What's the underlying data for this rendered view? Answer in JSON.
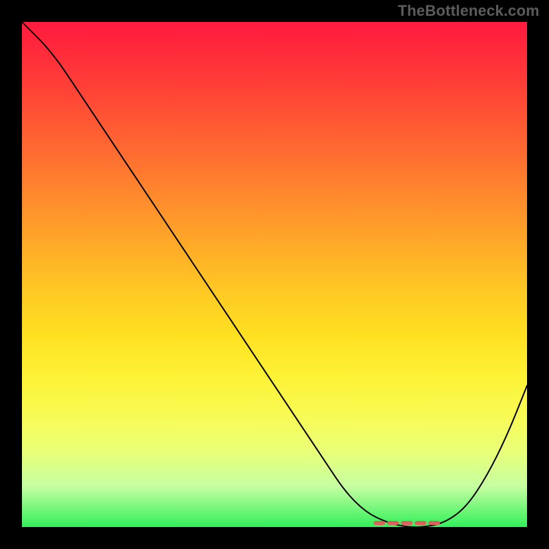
{
  "watermark": "TheBottleneck.com",
  "chart_data": {
    "type": "line",
    "title": "",
    "xlabel": "",
    "ylabel": "",
    "xlim": [
      0,
      100
    ],
    "ylim": [
      0,
      100
    ],
    "series": [
      {
        "name": "bottleneck-curve",
        "x": [
          0,
          6,
          12,
          18,
          24,
          30,
          36,
          42,
          48,
          54,
          60,
          64,
          68,
          72,
          76,
          80,
          84,
          88,
          92,
          96,
          100
        ],
        "y": [
          100,
          94,
          85,
          76,
          67,
          58,
          49,
          40,
          31,
          22,
          13,
          7,
          3,
          1,
          0,
          0,
          1,
          4,
          10,
          18,
          28
        ]
      }
    ],
    "min_marker": {
      "x_range": [
        70,
        83
      ],
      "color": "#d8635c"
    },
    "gradient_stops": [
      {
        "pos": 0,
        "color": "#ff1a40"
      },
      {
        "pos": 22,
        "color": "#ff5f33"
      },
      {
        "pos": 46,
        "color": "#ffb027"
      },
      {
        "pos": 70,
        "color": "#fdf235"
      },
      {
        "pos": 92,
        "color": "#c6ffa2"
      },
      {
        "pos": 100,
        "color": "#31f05a"
      }
    ]
  }
}
